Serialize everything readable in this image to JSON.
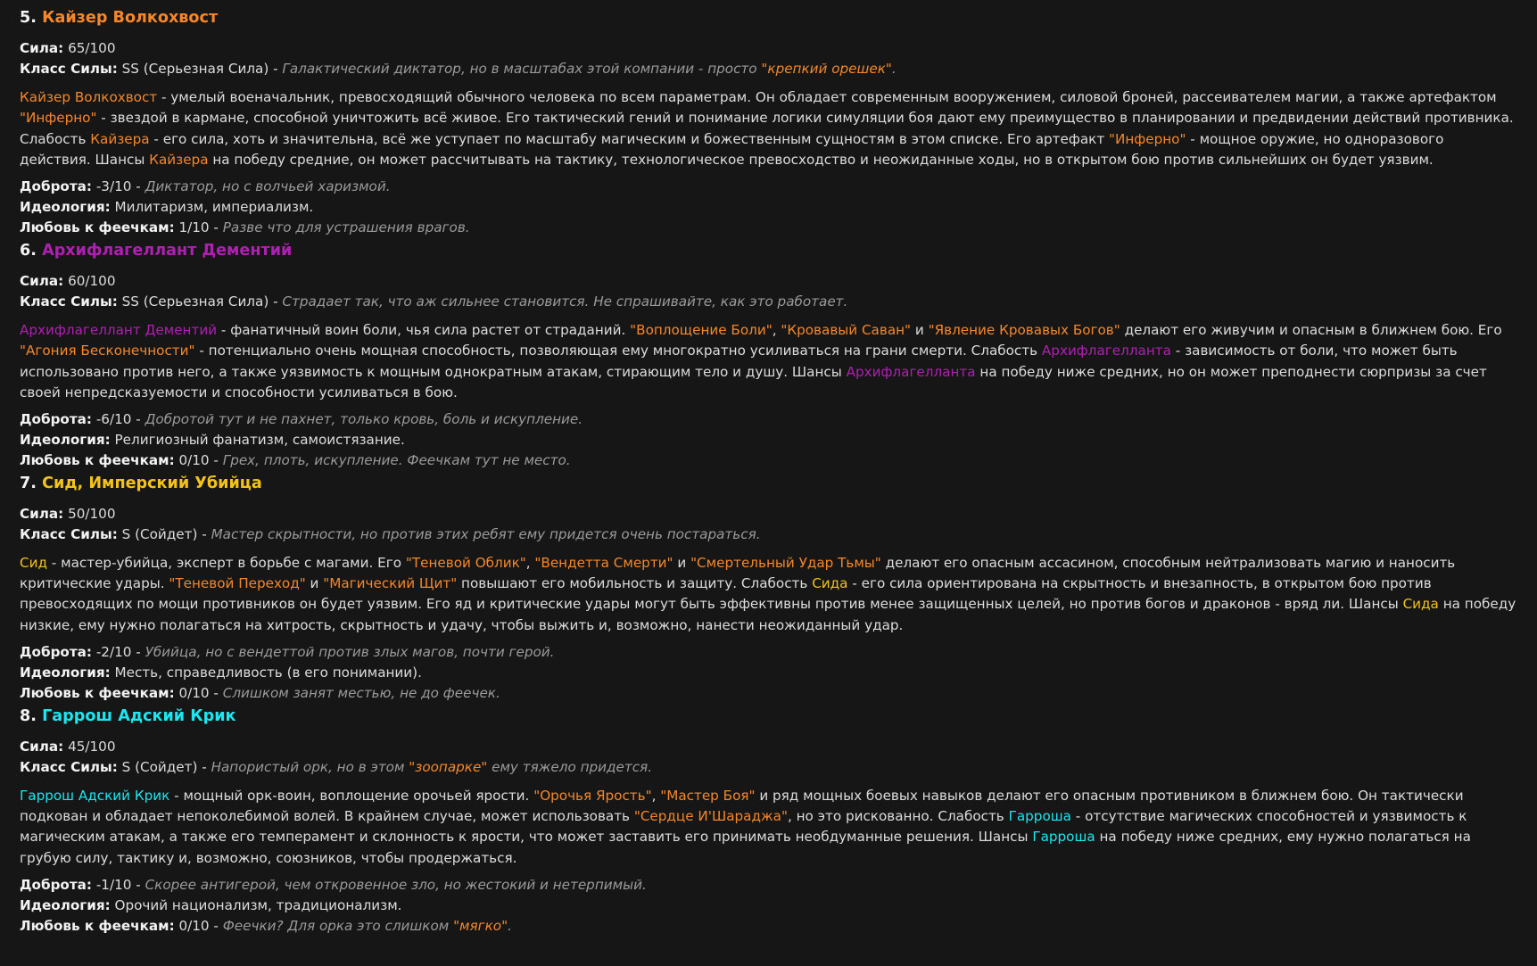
{
  "colors": {
    "text": "#dcdcdc",
    "bold": "#f2f2f2",
    "comment": "#9a9a9a",
    "orange": "#f5872a",
    "purple": "#b01fb3",
    "yellow": "#f3c31a",
    "cyan": "#1ce6f0"
  },
  "labels": {
    "power": "Сила:",
    "power_class": "Класс Силы:",
    "kindness": "Доброта:",
    "ideology": "Идеология:",
    "fairy_love": "Любовь к феечкам:"
  },
  "sections": [
    {
      "num": "5.",
      "title": "Кайзер Волкохвост",
      "color": "#f5872a",
      "power": "65/100",
      "power_class": [
        {
          "t": "SS (Серьезная Сила) - "
        },
        {
          "t": "Галактический диктатор, но в масштабах этой компании - просто ",
          "s": "cmt"
        },
        {
          "t": "\"крепкий орешек\"",
          "c": "orange",
          "s": "cmt"
        },
        {
          "t": ".",
          "s": "cmt"
        }
      ],
      "paragraph": [
        {
          "t": "Кайзер Волкохвост",
          "c": "orange"
        },
        {
          "t": " - умелый военачальник, превосходящий обычного человека по всем параметрам. Он обладает современным вооружением, силовой броней, рассеивателем магии, а также артефактом "
        },
        {
          "t": "\"Инферно\"",
          "c": "orange"
        },
        {
          "t": " - звездой в кармане, способной уничтожить всё живое. Его тактический гений и понимание логики симуляции боя дают ему преимущество в планировании и предвидении действий противника. Слабость "
        },
        {
          "t": "Кайзера",
          "c": "orange"
        },
        {
          "t": " - его сила, хоть и значительна, всё же уступает по масштабу магическим и божественным сущностям в этом списке. Его артефакт "
        },
        {
          "t": "\"Инферно\"",
          "c": "orange"
        },
        {
          "t": " - мощное оружие, но одноразового действия. Шансы "
        },
        {
          "t": "Кайзера",
          "c": "orange"
        },
        {
          "t": " на победу средние, он может рассчитывать на тактику, технологическое превосходство и неожиданные ходы, но в открытом бою против сильнейших он будет уязвим."
        }
      ],
      "kindness": [
        {
          "t": "-3/10 - "
        },
        {
          "t": "Диктатор, но с волчьей харизмой.",
          "s": "cmt"
        }
      ],
      "ideology": [
        {
          "t": "Милитаризм, империализм."
        }
      ],
      "fairy_love": [
        {
          "t": "1/10 - "
        },
        {
          "t": "Разве что для устрашения врагов.",
          "s": "cmt"
        }
      ]
    },
    {
      "num": "6.",
      "title": "Архифлагеллант Дементий",
      "color": "#b01fb3",
      "power": "60/100",
      "power_class": [
        {
          "t": "SS (Серьезная Сила) - "
        },
        {
          "t": "Страдает так, что аж сильнее становится. Не спрашивайте, как это работает.",
          "s": "cmt"
        }
      ],
      "paragraph": [
        {
          "t": "Архифлагеллант Дементий",
          "c": "purple"
        },
        {
          "t": " - фанатичный воин боли, чья сила растет от страданий. "
        },
        {
          "t": "\"Воплощение Боли\"",
          "c": "orange"
        },
        {
          "t": ", "
        },
        {
          "t": "\"Кровавый Саван\"",
          "c": "orange"
        },
        {
          "t": " и "
        },
        {
          "t": "\"Явление Кровавых Богов\"",
          "c": "orange"
        },
        {
          "t": " делают его живучим и опасным в ближнем бою. Его "
        },
        {
          "t": "\"Агония Бесконечности\"",
          "c": "orange"
        },
        {
          "t": " - потенциально очень мощная способность, позволяющая ему многократно усиливаться на грани смерти. Слабость "
        },
        {
          "t": "Архифлагелланта",
          "c": "purple"
        },
        {
          "t": " - зависимость от боли, что может быть использовано против него, а также уязвимость к мощным однократным атакам, стирающим тело и душу. Шансы "
        },
        {
          "t": "Архифлагелланта",
          "c": "purple"
        },
        {
          "t": " на победу ниже средних, но он может преподнести сюрпризы за счет своей непредсказуемости и способности усиливаться в бою."
        }
      ],
      "kindness": [
        {
          "t": "-6/10 - "
        },
        {
          "t": "Добротой тут и не пахнет, только кровь, боль и искупление.",
          "s": "cmt"
        }
      ],
      "ideology": [
        {
          "t": "Религиозный фанатизм, самоистязание."
        }
      ],
      "fairy_love": [
        {
          "t": "0/10 - "
        },
        {
          "t": "Грех, плоть, искупление. Феечкам тут не место.",
          "s": "cmt"
        }
      ]
    },
    {
      "num": "7.",
      "title": "Сид, Имперский Убийца",
      "color": "#f3c31a",
      "power": "50/100",
      "power_class": [
        {
          "t": "S (Сойдет) - "
        },
        {
          "t": "Мастер скрытности, но против этих ребят ему придется очень постараться.",
          "s": "cmt"
        }
      ],
      "paragraph": [
        {
          "t": "Сид",
          "c": "yellow"
        },
        {
          "t": " - мастер-убийца, эксперт в борьбе с магами. Его "
        },
        {
          "t": "\"Теневой Облик\"",
          "c": "orange"
        },
        {
          "t": ", "
        },
        {
          "t": "\"Вендетта Смерти\"",
          "c": "orange"
        },
        {
          "t": " и "
        },
        {
          "t": "\"Смертельный Удар Тьмы\"",
          "c": "orange"
        },
        {
          "t": " делают его опасным ассасином, способным нейтрализовать магию и наносить критические удары. "
        },
        {
          "t": "\"Теневой Переход\"",
          "c": "orange"
        },
        {
          "t": " и "
        },
        {
          "t": "\"Магический Щит\"",
          "c": "orange"
        },
        {
          "t": " повышают его мобильность и защиту. Слабость "
        },
        {
          "t": "Сида",
          "c": "yellow"
        },
        {
          "t": " - его сила ориентирована на скрытность и внезапность, в открытом бою против превосходящих по мощи противников он будет уязвим. Его яд и критические удары могут быть эффективны против менее защищенных целей, но против богов и драконов - вряд ли. Шансы "
        },
        {
          "t": "Сида",
          "c": "yellow"
        },
        {
          "t": " на победу низкие, ему нужно полагаться на хитрость, скрытность и удачу, чтобы выжить и, возможно, нанести неожиданный удар."
        }
      ],
      "kindness": [
        {
          "t": "-2/10 - "
        },
        {
          "t": "Убийца, но с вендеттой против злых магов, почти герой.",
          "s": "cmt"
        }
      ],
      "ideology": [
        {
          "t": "Месть, справедливость (в его понимании)."
        }
      ],
      "fairy_love": [
        {
          "t": "0/10 - "
        },
        {
          "t": "Слишком занят местью, не до феечек.",
          "s": "cmt"
        }
      ]
    },
    {
      "num": "8.",
      "title": "Гаррош Адский Крик",
      "color": "#1ce6f0",
      "power": "45/100",
      "power_class": [
        {
          "t": "S (Сойдет) - "
        },
        {
          "t": "Напористый орк, но в этом ",
          "s": "cmt"
        },
        {
          "t": "\"зоопарке\"",
          "c": "orange",
          "s": "cmt"
        },
        {
          "t": " ему тяжело придется.",
          "s": "cmt"
        }
      ],
      "paragraph": [
        {
          "t": "Гаррош Адский Крик",
          "c": "cyan"
        },
        {
          "t": " - мощный орк-воин, воплощение орочьей ярости. "
        },
        {
          "t": "\"Орочья Ярость\"",
          "c": "orange"
        },
        {
          "t": ", "
        },
        {
          "t": "\"Мастер Боя\"",
          "c": "orange"
        },
        {
          "t": " и ряд мощных боевых навыков делают его опасным противником в ближнем бою. Он тактически подкован и обладает непоколебимой волей. В крайнем случае, может использовать "
        },
        {
          "t": "\"Сердце И'Шараджа\"",
          "c": "orange"
        },
        {
          "t": ", но это рискованно. Слабость "
        },
        {
          "t": "Гарроша",
          "c": "cyan"
        },
        {
          "t": " - отсутствие магических способностей и уязвимость к магическим атакам, а также его темперамент и склонность к ярости, что может заставить его принимать необдуманные решения. Шансы "
        },
        {
          "t": "Гарроша",
          "c": "cyan"
        },
        {
          "t": " на победу ниже средних, ему нужно полагаться на грубую силу, тактику и, возможно, союзников, чтобы продержаться."
        }
      ],
      "kindness": [
        {
          "t": "-1/10 - "
        },
        {
          "t": "Скорее антигерой, чем откровенное зло, но жестокий и нетерпимый.",
          "s": "cmt"
        }
      ],
      "ideology": [
        {
          "t": "Орочий национализм, традиционализм."
        }
      ],
      "fairy_love": [
        {
          "t": "0/10 - "
        },
        {
          "t": "Феечки? Для орка это слишком ",
          "s": "cmt"
        },
        {
          "t": "\"мягко\"",
          "c": "orange",
          "s": "cmt"
        },
        {
          "t": ".",
          "s": "cmt"
        }
      ]
    }
  ]
}
